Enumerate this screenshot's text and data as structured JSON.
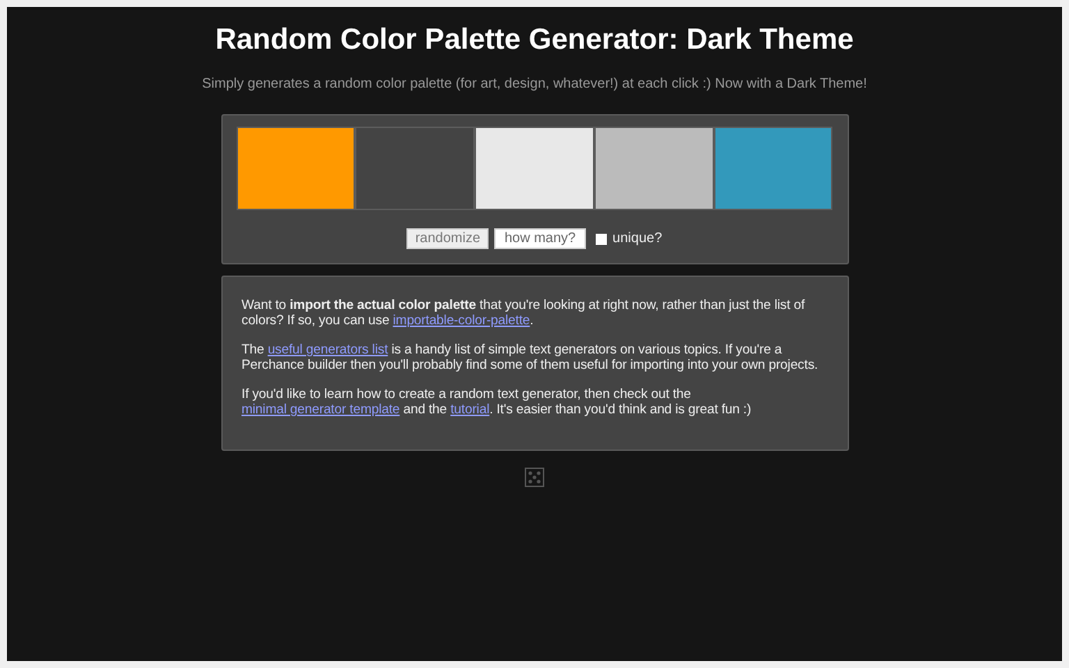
{
  "title": "Random Color Palette Generator: Dark Theme",
  "subtitle": "Simply generates a random color palette (for art, design, whatever!) at each click :) Now with a Dark Theme!",
  "palette": [
    {
      "color": "#ff9900"
    },
    {
      "color": "#444444"
    },
    {
      "color": "#e8e8e8"
    },
    {
      "color": "#bbbbbb"
    },
    {
      "color": "#3399bb"
    }
  ],
  "controls": {
    "button": "randomize",
    "count_placeholder": "how many?",
    "unique": {
      "label": "unique?",
      "checked": false
    }
  },
  "info": [
    [
      {
        "kind": "text",
        "text": "Want to "
      },
      {
        "kind": "bold",
        "text": "import the actual color palette"
      },
      {
        "kind": "text",
        "text": " that you're looking at right now, rather than just the list of colors? If so, you can use "
      },
      {
        "kind": "link",
        "text": "importable-color-palette"
      },
      {
        "kind": "text",
        "text": "."
      }
    ],
    [
      {
        "kind": "text",
        "text": "The "
      },
      {
        "kind": "link",
        "text": "useful generators list"
      },
      {
        "kind": "text",
        "text": " is a handy list of simple text generators on various topics. If you're a Perchance builder then you'll probably find some of them useful for importing into your own projects."
      }
    ],
    [
      {
        "kind": "text",
        "text": "If you'd like to learn how to create a random text generator, then check out the "
      },
      {
        "kind": "link",
        "text": "minimal generator template"
      },
      {
        "kind": "text",
        "text": " and the "
      },
      {
        "kind": "link",
        "text": "tutorial"
      },
      {
        "kind": "text",
        "text": ". It's easier than you'd think and is great fun :)"
      }
    ]
  ]
}
